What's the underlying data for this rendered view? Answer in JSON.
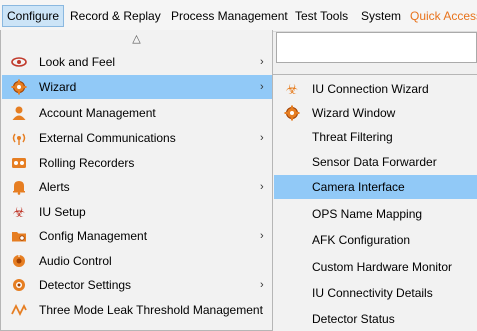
{
  "menubar": {
    "items": [
      "Configure",
      "Record & Replay",
      "Process Management",
      "Test Tools",
      "System",
      "Quick Access"
    ],
    "active_index": 0,
    "quick_access_color": "#e8731c"
  },
  "dropdown": {
    "scroll_up_icon": "triangle-up-icon",
    "items": [
      {
        "label": "Look and Feel",
        "icon": "eye-icon",
        "has_submenu": true
      },
      {
        "label": "Wizard",
        "icon": "gear-icon",
        "has_submenu": true,
        "highlighted": true
      },
      {
        "label": "Account Management",
        "icon": "user-icon",
        "has_submenu": false
      },
      {
        "label": "External Communications",
        "icon": "antenna-icon",
        "has_submenu": true
      },
      {
        "label": "Rolling Recorders",
        "icon": "recorder-icon",
        "has_submenu": false
      },
      {
        "label": "Alerts",
        "icon": "bell-icon",
        "has_submenu": true
      },
      {
        "label": "IU Setup",
        "icon": "biohazard-icon",
        "has_submenu": false
      },
      {
        "label": "Config Management",
        "icon": "folder-icon",
        "has_submenu": true
      },
      {
        "label": "Audio Control",
        "icon": "audio-icon",
        "has_submenu": false
      },
      {
        "label": "Detector Settings",
        "icon": "detector-icon",
        "has_submenu": true
      },
      {
        "label": "Three Mode Leak Threshold Management",
        "icon": "wave-icon",
        "has_submenu": false
      }
    ],
    "arrow": "›",
    "highlight_color": "#91c9f7"
  },
  "submenu": {
    "items": [
      {
        "label": "IU Connection Wizard",
        "icon": "biohazard-icon"
      },
      {
        "label": "Wizard Window",
        "icon": "gear-icon"
      },
      {
        "label": "Threat Filtering",
        "icon": ""
      },
      {
        "label": "Sensor Data Forwarder",
        "icon": ""
      },
      {
        "label": "Camera Interface",
        "icon": "",
        "highlighted": true
      },
      {
        "label": "OPS Name Mapping",
        "icon": ""
      },
      {
        "label": "AFK Configuration",
        "icon": ""
      },
      {
        "label": "Custom Hardware Monitor",
        "icon": ""
      },
      {
        "label": "IU Connectivity Details",
        "icon": ""
      },
      {
        "label": "Detector Status",
        "icon": ""
      }
    ]
  }
}
